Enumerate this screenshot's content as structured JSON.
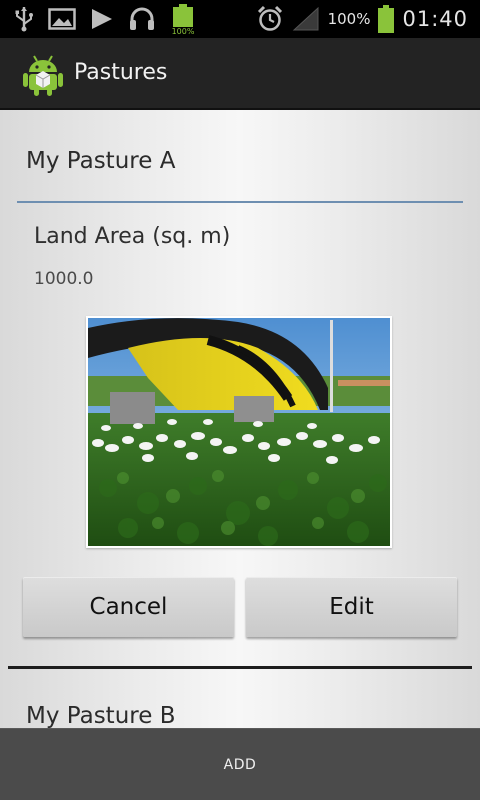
{
  "status_bar": {
    "battery_small_label": "100%",
    "battery_percent": "100%",
    "time": "01:40",
    "icons": [
      "usb-icon",
      "image-icon",
      "play-icon",
      "headset-icon",
      "battery-icon",
      "alarm-icon",
      "signal-icon",
      "battery-icon"
    ]
  },
  "action_bar": {
    "title": "Pastures",
    "logo": "android-icon"
  },
  "pasture_a": {
    "title": "My Pasture A",
    "field_label": "Land Area (sq. m)",
    "field_value": "1000.0",
    "photo": "pasture-photo",
    "cancel_label": "Cancel",
    "edit_label": "Edit"
  },
  "pasture_b": {
    "title": "My Pasture B"
  },
  "bottom_bar": {
    "add_label": "ADD"
  },
  "colors": {
    "accent_divider": "#6e8fb1",
    "action_bar": "#232323",
    "bottom_bar": "#4b4b4b",
    "battery_green": "#8ac33a"
  }
}
